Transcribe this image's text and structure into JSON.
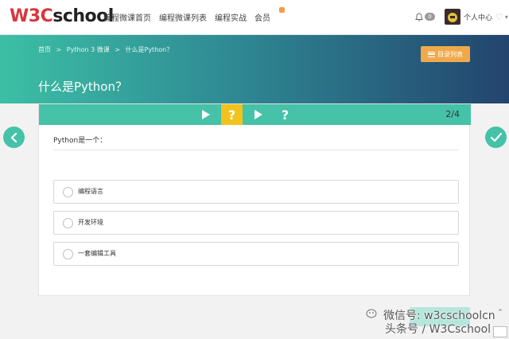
{
  "brand": {
    "logo_w3c": "W3C",
    "logo_school": "school"
  },
  "nav": {
    "items": [
      {
        "label": "编程微课首页"
      },
      {
        "label": "编程微课列表"
      },
      {
        "label": "编程实战"
      },
      {
        "label": "会员"
      }
    ],
    "notification_count": "0",
    "profile_label": "个人中心"
  },
  "hero": {
    "breadcrumb": [
      "首页",
      ">",
      "Python 3 微课",
      ">",
      "什么是Python？"
    ],
    "title": "什么是Python？",
    "toc_label": "目录列表"
  },
  "quiz": {
    "steps": [
      {
        "type": "play",
        "icon": "play-icon"
      },
      {
        "type": "question",
        "label": "?",
        "active": true
      },
      {
        "type": "play",
        "icon": "play-icon"
      },
      {
        "type": "question",
        "label": "?",
        "active": false
      }
    ],
    "counter": "2/4",
    "question": "Python是一个：",
    "options": [
      {
        "label": "编程语言"
      },
      {
        "label": "开发环境"
      },
      {
        "label": "一套编辑工具"
      }
    ]
  },
  "watermark": {
    "line1": "微信号: w3cschoolcn",
    "line2": "头条号 / W3Cschool"
  },
  "colors": {
    "accent": "#45c2a7",
    "active_step": "#f2c21e",
    "toc_button": "#f0a94a",
    "logo_red": "#d9363e"
  }
}
